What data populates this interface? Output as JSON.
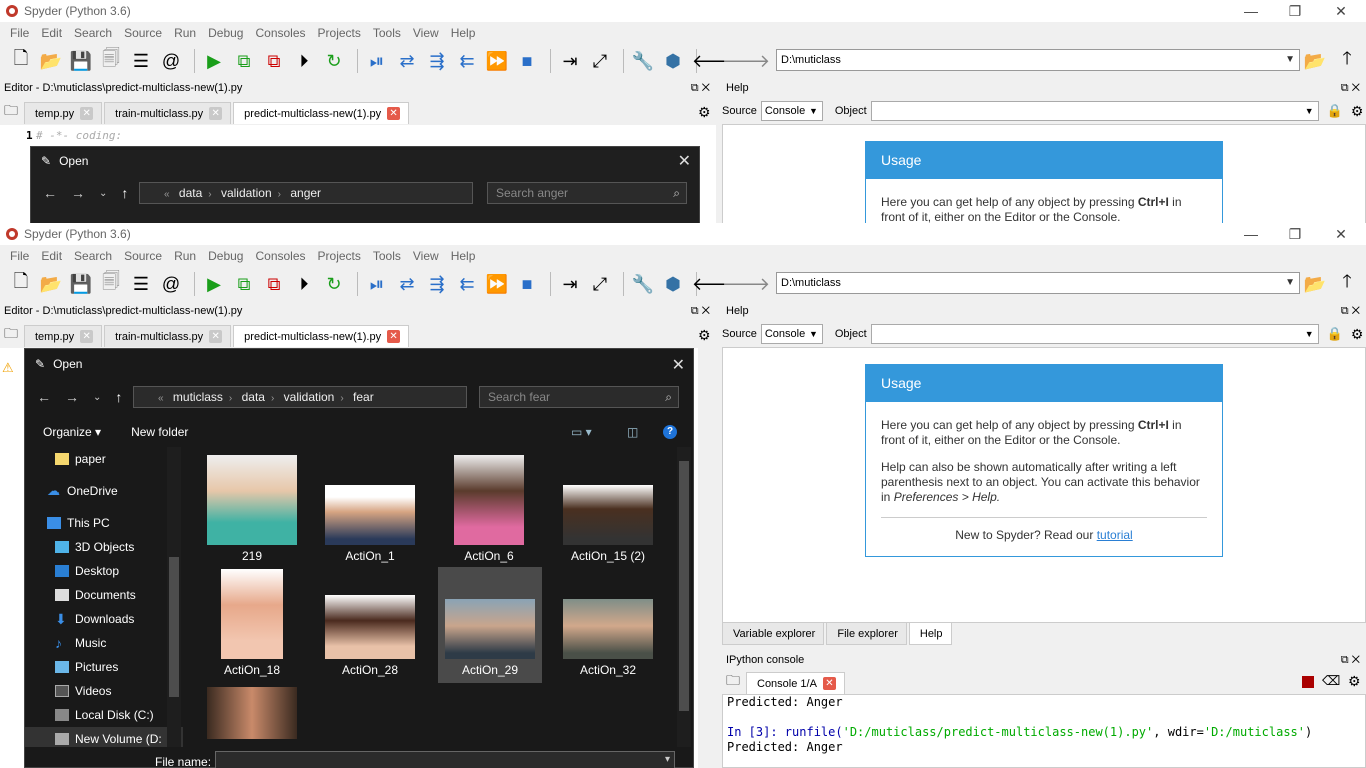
{
  "app": {
    "title": "Spyder (Python 3.6)",
    "menu": [
      "File",
      "Edit",
      "Search",
      "Source",
      "Run",
      "Debug",
      "Consoles",
      "Projects",
      "Tools",
      "View",
      "Help"
    ],
    "path": "D:\\muticlass"
  },
  "editor": {
    "header": "Editor - D:\\muticlass\\predict-multiclass-new(1).py",
    "tabs": [
      "temp.py",
      "train-multiclass.py",
      "predict-multiclass-new(1).py"
    ],
    "line1_num": "1",
    "line1_code": "# -*- coding:"
  },
  "help": {
    "header": "Help",
    "source_label": "Source",
    "source_value": "Console",
    "object_label": "Object",
    "usage_title": "Usage",
    "usage_p1a": "Here you can get help of any object by pressing ",
    "usage_p1b": "Ctrl+I",
    "usage_p1c": " in front of it, either on the Editor or the Console.",
    "usage_p2a": "Help can also be shown automatically after writing a left parenthesis next to an object. You can activate this behavior in ",
    "usage_p2b": "Preferences > Help.",
    "usage_tut": "New to Spyder? Read our ",
    "usage_tut_link": "tutorial",
    "bottom_tabs": [
      "Variable explorer",
      "File explorer",
      "Help"
    ]
  },
  "console": {
    "header": "IPython console",
    "tab": "Console 1/A",
    "line1": "Predicted: Anger",
    "line2_prompt": "In [3]: runfile(",
    "line2_arg1": "'D:/muticlass/predict-multiclass-new(1).py'",
    "line2_mid": ", wdir=",
    "line2_arg2": "'D:/muticlass'",
    "line2_end": ")",
    "line3": "Predicted: Anger"
  },
  "dialog1": {
    "title": "Open",
    "crumbs": [
      "data",
      "validation",
      "anger"
    ],
    "search": "Search anger"
  },
  "dialog2": {
    "title": "Open",
    "crumbs": [
      "muticlass",
      "data",
      "validation",
      "fear"
    ],
    "search": "Search fear",
    "organize": "Organize",
    "new_folder": "New folder",
    "sidebar": [
      "paper",
      "OneDrive",
      "This PC",
      "3D Objects",
      "Desktop",
      "Documents",
      "Downloads",
      "Music",
      "Pictures",
      "Videos",
      "Local Disk (C:)",
      "New Volume (D:"
    ],
    "files": [
      "219",
      "ActiOn_1",
      "ActiOn_6",
      "ActiOn_15 (2)",
      "ActiOn_18",
      "ActiOn_28",
      "ActiOn_29",
      "ActiOn_32"
    ],
    "file_name_label": "File name:"
  }
}
